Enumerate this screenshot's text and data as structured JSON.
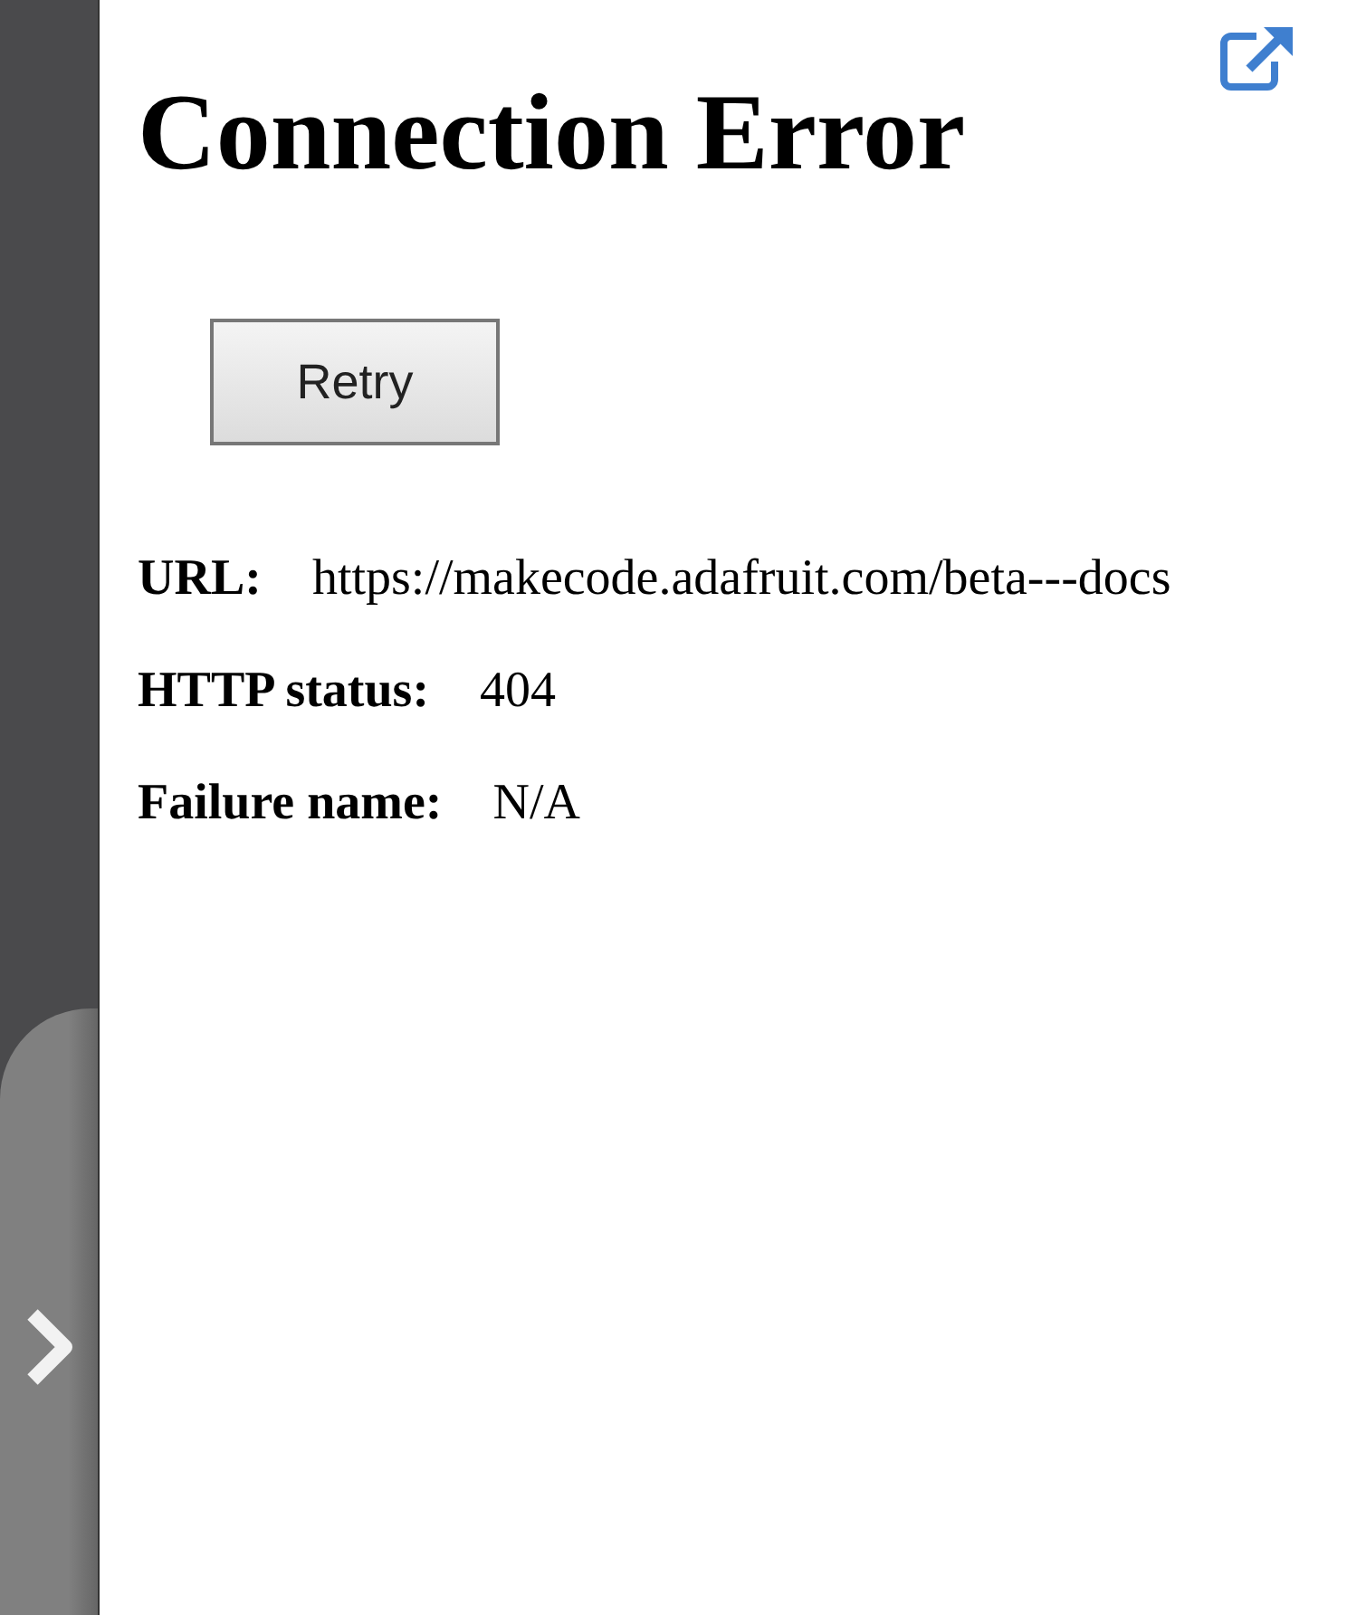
{
  "title": "Connection Error",
  "retry_button": {
    "label": "Retry"
  },
  "details": [
    {
      "label": "URL:",
      "value": "https://makecode.adafruit.com/beta---docs"
    },
    {
      "label": "HTTP status:",
      "value": "404"
    },
    {
      "label": "Failure name:",
      "value": "N/A"
    }
  ]
}
